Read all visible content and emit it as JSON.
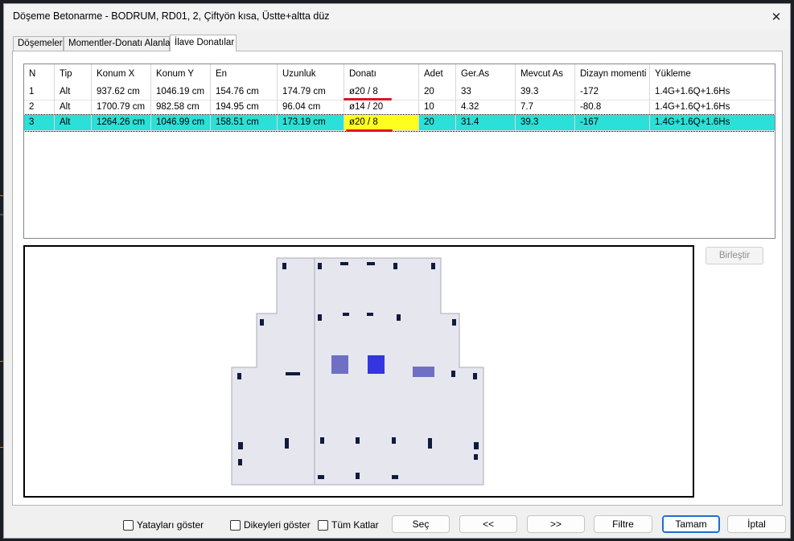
{
  "window": {
    "title": "Döşeme Betonarme - BODRUM, RD01, 2, Çiftyön kısa, Üstte+altta düz"
  },
  "tabs": [
    {
      "label": "Döşemeler"
    },
    {
      "label": "Momentler-Donatı Alanları"
    },
    {
      "label": "İlave Donatılar"
    }
  ],
  "table": {
    "columns": [
      "N",
      "Tip",
      "Konum X",
      "Konum Y",
      "En",
      "Uzunluk",
      "Donatı",
      "Adet",
      "Ger.As",
      "Mevcut As",
      "Dizayn momenti",
      "Yükleme"
    ],
    "rows": [
      [
        "1",
        "Alt",
        "937.62 cm",
        "1046.19 cm",
        "154.76 cm",
        "174.79 cm",
        "ø20 / 8",
        "20",
        "33",
        "39.3",
        "-172",
        "1.4G+1.6Q+1.6Hs"
      ],
      [
        "2",
        "Alt",
        "1700.79 cm",
        "982.58 cm",
        "194.95 cm",
        "96.04 cm",
        "ø14 / 20",
        "10",
        "4.32",
        "7.7",
        "-80.8",
        "1.4G+1.6Q+1.6Hs"
      ],
      [
        "3",
        "Alt",
        "1264.26 cm",
        "1046.99 cm",
        "158.51 cm",
        "173.19 cm",
        "ø20 / 8",
        "20",
        "31.4",
        "39.3",
        "-167",
        "1.4G+1.6Q+1.6Hs"
      ]
    ],
    "selected_row": 3
  },
  "buttons": {
    "birlestir": "Birleştir",
    "sec": "Seç",
    "prev": "<<",
    "next": ">>",
    "filtre": "Filtre",
    "tamam": "Tamam",
    "iptal": "İptal"
  },
  "checkboxes": {
    "yataylari": "Yatayları göster",
    "dikeyleri": "Dikeyleri göster",
    "tum_katlar": "Tüm Katlar"
  },
  "colors": {
    "selection": "#2ae0d8",
    "highlight": "#ffff1f",
    "underline": "#e0141e",
    "slab": "#e6e6ef",
    "reinforcement": "#0f1b3d",
    "highlight_patch": "#6f6fc4",
    "selected_patch": "#3434e0"
  }
}
